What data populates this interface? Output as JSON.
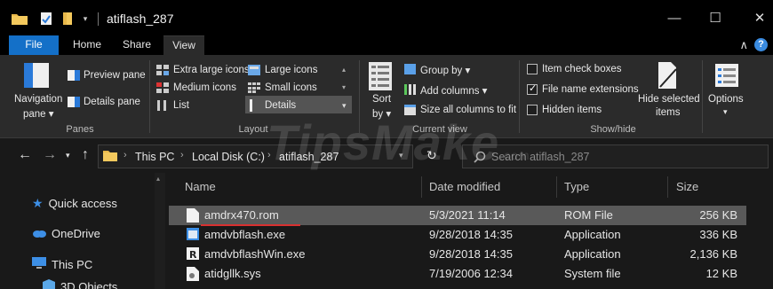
{
  "window": {
    "title": "atiflash_287",
    "controls": {
      "minimize": "—",
      "maximize": "☐",
      "close": "✕"
    }
  },
  "tabs": [
    {
      "label": "File"
    },
    {
      "label": "Home"
    },
    {
      "label": "Share"
    },
    {
      "label": "View"
    }
  ],
  "ribbon": {
    "panes": {
      "navigation_pane": "Navigation",
      "navigation_pane_2": "pane ▾",
      "preview_pane": "Preview pane",
      "details_pane": "Details pane",
      "group_label": "Panes"
    },
    "layout": {
      "extra_large_icons": "Extra large icons",
      "large_icons": "Large icons",
      "medium_icons": "Medium icons",
      "small_icons": "Small icons",
      "list": "List",
      "details": "Details",
      "group_label": "Layout"
    },
    "current_view": {
      "sort_by": "Sort",
      "sort_by_2": "by ▾",
      "group_by": "Group by ▾",
      "add_columns": "Add columns ▾",
      "size_all_columns": "Size all columns to fit",
      "group_label": "Current view"
    },
    "show_hide": {
      "item_check_boxes": "Item check boxes",
      "file_name_extensions": "File name extensions",
      "hidden_items": "Hidden items",
      "hide_selected": "Hide selected",
      "hide_selected_2": "items",
      "group_label": "Show/hide",
      "checks": {
        "item_check_boxes": false,
        "file_name_extensions": true,
        "hidden_items": false
      }
    },
    "options": {
      "label": "Options",
      "arrow": "▾"
    }
  },
  "address": {
    "breadcrumbs": [
      "This PC",
      "Local Disk (C:)",
      "atiflash_287"
    ],
    "search_placeholder": "Search atiflash_287"
  },
  "nav_pane": {
    "items": [
      {
        "label": "Quick access",
        "icon": "star-icon"
      },
      {
        "label": "OneDrive",
        "icon": "cloud-icon"
      },
      {
        "label": "This PC",
        "icon": "computer-icon"
      },
      {
        "label": "3D Objects",
        "icon": "cube-icon"
      }
    ]
  },
  "file_list": {
    "columns": [
      "Name",
      "Date modified",
      "Type",
      "Size"
    ],
    "rows": [
      {
        "name": "amdrx470.rom",
        "date": "5/3/2021 11:14",
        "type": "ROM File",
        "size": "256 KB",
        "icon": "file-icon",
        "selected": true
      },
      {
        "name": "amdvbflash.exe",
        "date": "9/28/2018 14:35",
        "type": "Application",
        "size": "336 KB",
        "icon": "app-icon",
        "selected": false
      },
      {
        "name": "amdvbflashWin.exe",
        "date": "9/28/2018 14:35",
        "type": "Application",
        "size": "2,136 KB",
        "icon": "r-app-icon",
        "selected": false
      },
      {
        "name": "atidgllk.sys",
        "date": "7/19/2006 12:34",
        "type": "System file",
        "size": "12 KB",
        "icon": "gear-file-icon",
        "selected": false
      }
    ]
  },
  "watermark": {
    "text": "TipsMake",
    "suffix": ".com"
  },
  "colors": {
    "accent": "#1470c8",
    "selected_row": "#595959",
    "annotation_underline": "#d93030"
  }
}
